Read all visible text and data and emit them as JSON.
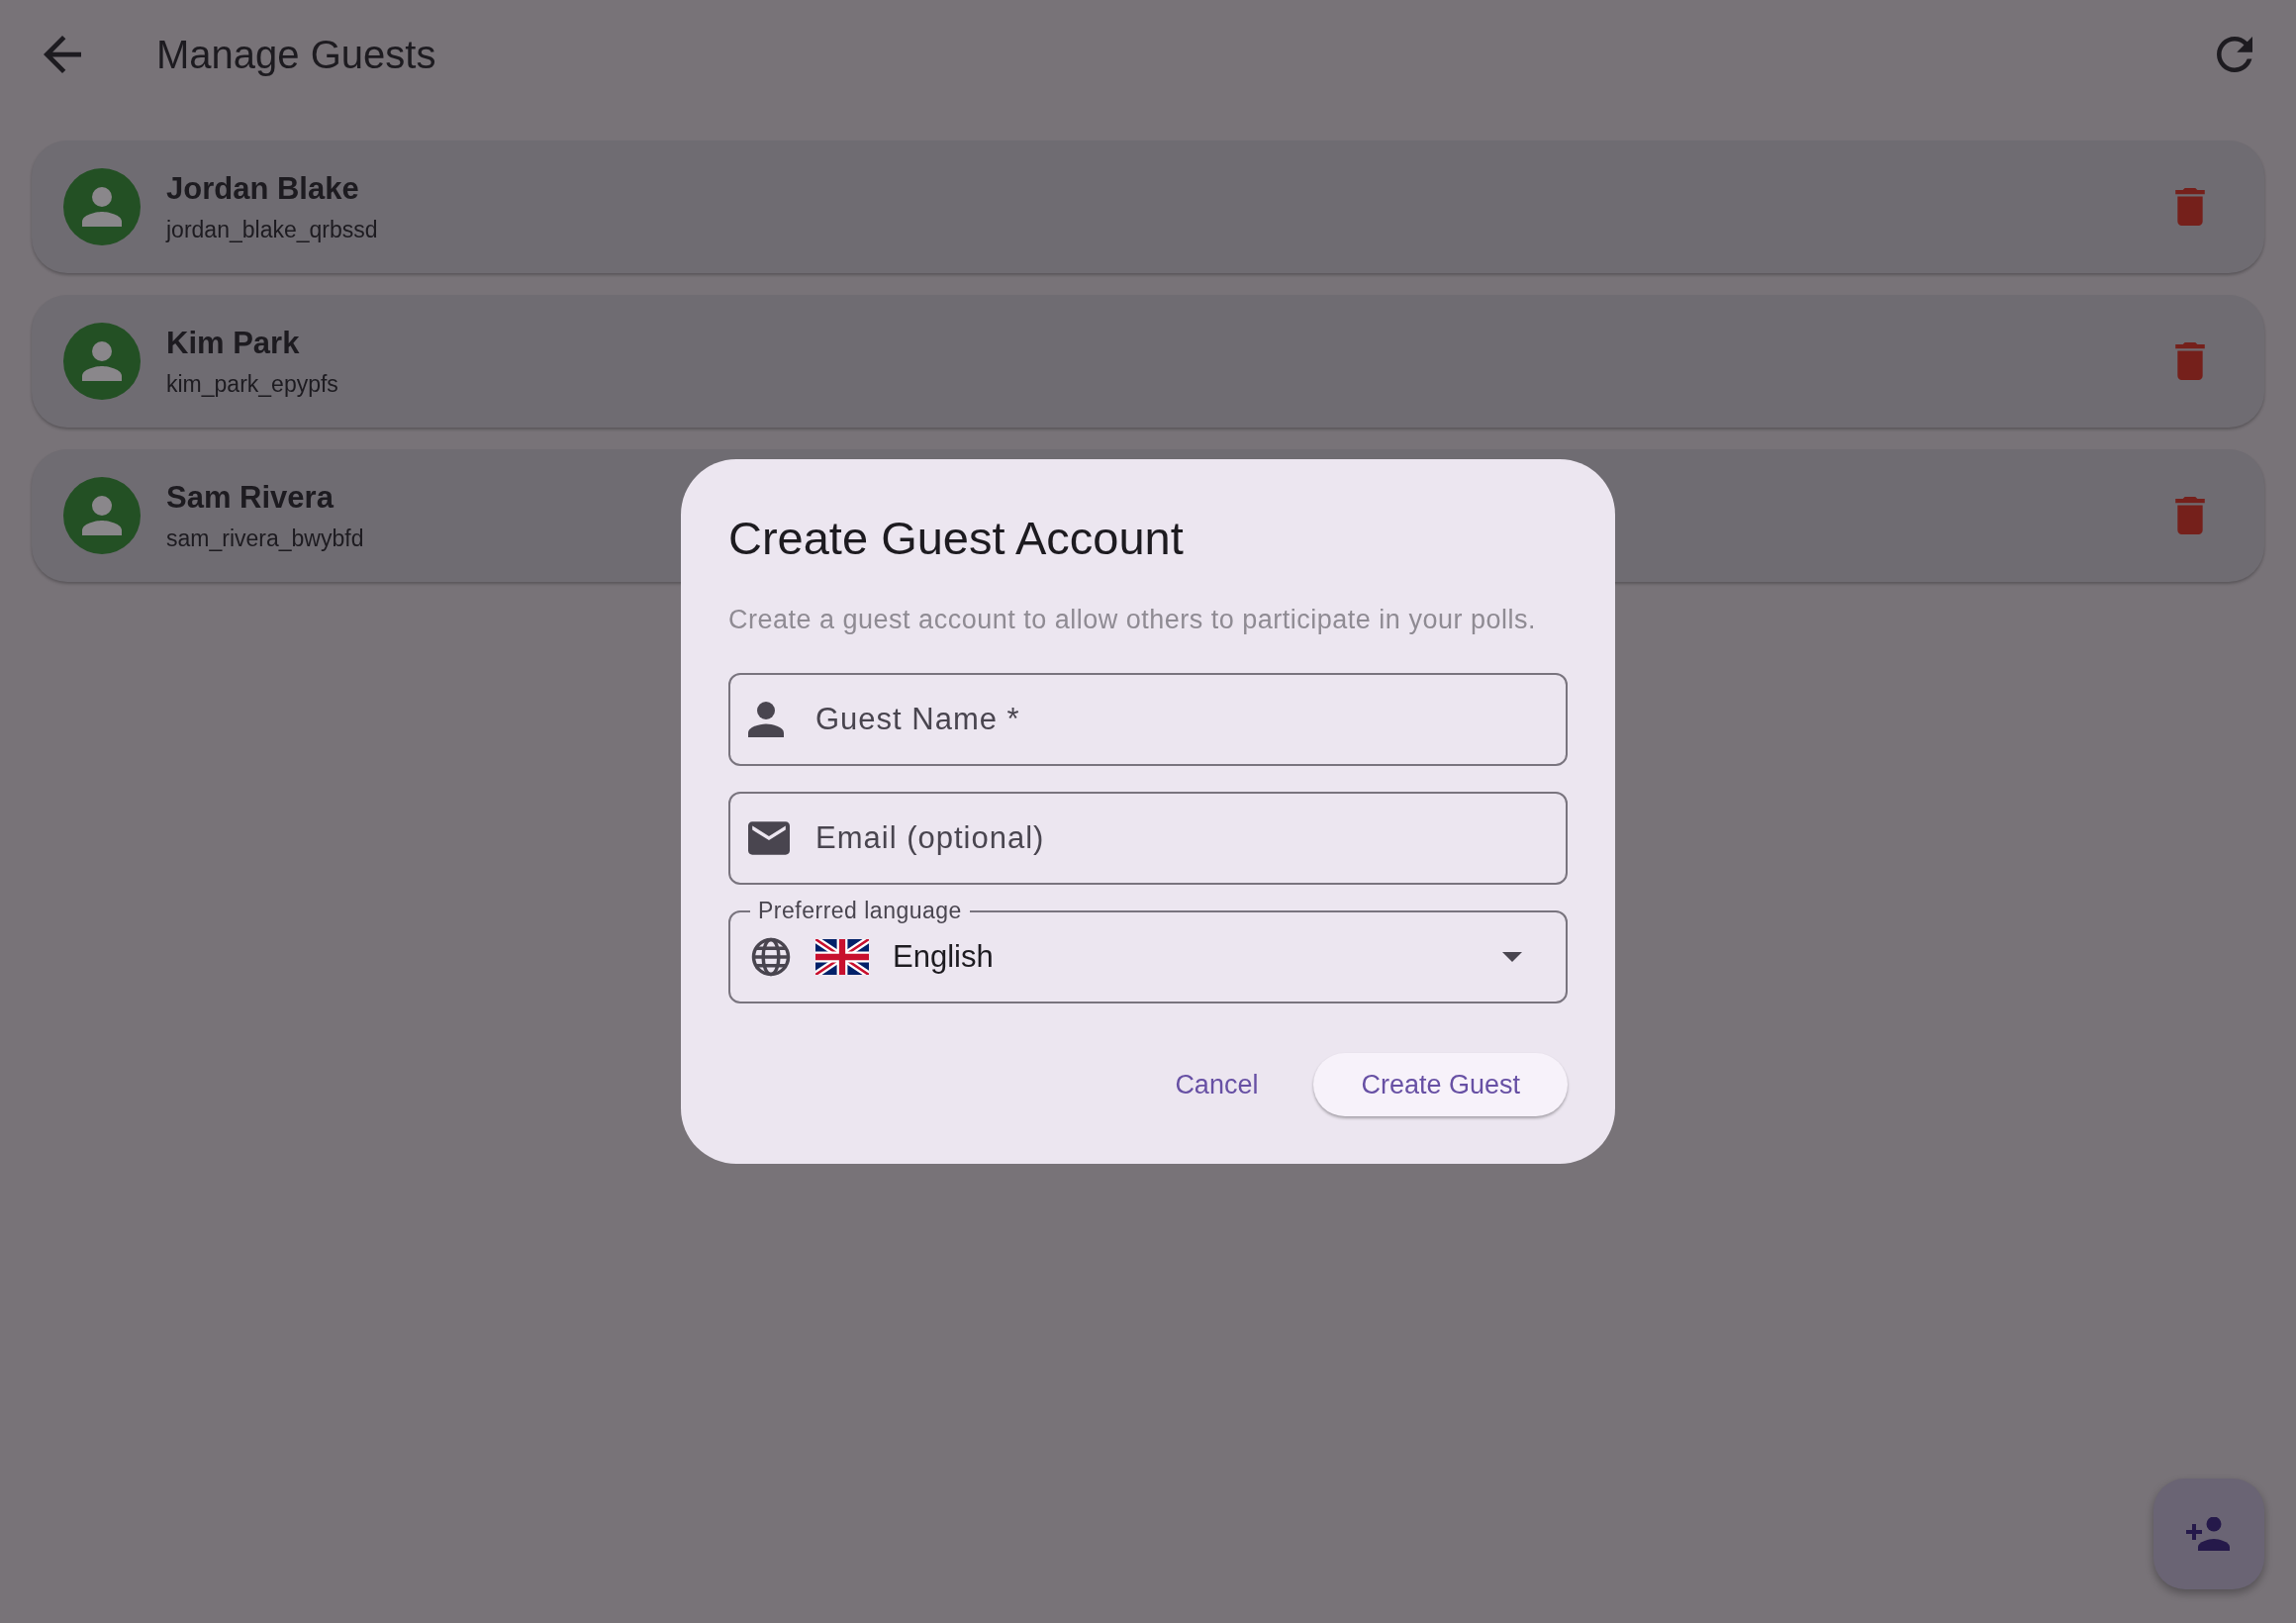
{
  "app_bar": {
    "title": "Manage Guests"
  },
  "guests": [
    {
      "name": "Jordan Blake",
      "username": "jordan_blake_qrbssd"
    },
    {
      "name": "Kim Park",
      "username": "kim_park_epypfs"
    },
    {
      "name": "Sam Rivera",
      "username": "sam_rivera_bwybfd"
    }
  ],
  "dialog": {
    "title": "Create Guest Account",
    "description": "Create a guest account to allow others to participate in your polls.",
    "fields": [
      {
        "kind": "name",
        "placeholder": "Guest Name *"
      },
      {
        "kind": "email",
        "placeholder": "Email (optional)"
      }
    ],
    "language": {
      "label": "Preferred language",
      "value": "English"
    },
    "buttons": [
      {
        "kind": "text",
        "label": "Cancel"
      },
      {
        "kind": "filled",
        "label": "Create Guest"
      }
    ]
  }
}
